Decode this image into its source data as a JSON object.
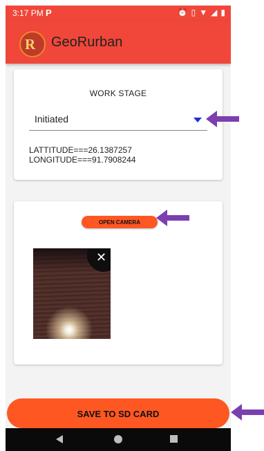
{
  "status_bar": {
    "time": "3:17 PM",
    "app_notification": "P",
    "icons": [
      "alarm-icon",
      "vibrate-icon",
      "wifi-icon",
      "signal-icon",
      "battery-icon"
    ]
  },
  "app_bar": {
    "logo_letter": "R",
    "title": "GeoRurban"
  },
  "location_card": {
    "stage_label": "WORK STAGE",
    "stage_value": "Initiated",
    "latitude": "LATTITUDE===26.1387257",
    "longitude": "LONGITUDE===91.7908244"
  },
  "camera_card": {
    "open_camera_label": "OPEN CAMERA",
    "close_glyph": "✕"
  },
  "save_button_label": "SAVE TO SD CARD",
  "colors": {
    "app_bar": "#f0473a",
    "accent_button": "#ff5722",
    "spinner_arrow": "#1a2fe0",
    "annotation_arrow": "#7b3fb0"
  }
}
